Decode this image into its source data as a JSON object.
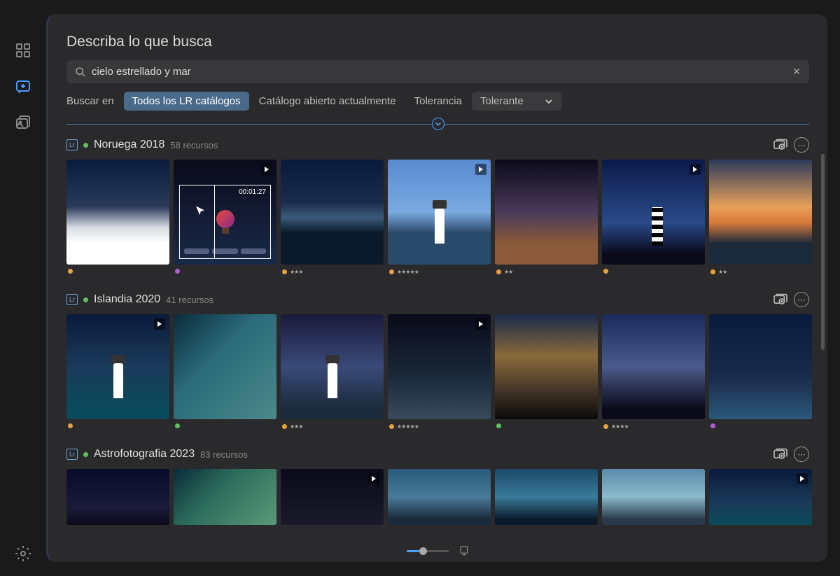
{
  "page_title": "Describa lo que busca",
  "search": {
    "value": "cielo estrellado y mar",
    "placeholder": ""
  },
  "filter": {
    "label": "Buscar en",
    "options": [
      "Todos los LR catálogos",
      "Catálogo abierto actualmente"
    ],
    "active_index": 0,
    "tolerance_label": "Tolerancia",
    "tolerance_value": "Tolerante"
  },
  "groups": [
    {
      "lr": "Lr",
      "dot": "green",
      "title": "Noruega 2018",
      "count": "58 recursos",
      "thumbs": [
        {
          "gradient": "linear-gradient(180deg,#0a1a3a 0%,#2a3a5a 45%,#d8dce4 65%,#fff 80%)",
          "dot": "orange",
          "stars": 0,
          "video": false
        },
        {
          "gradient": "linear-gradient(180deg,#0a0a1a 0%,#1a2a4a 100%)",
          "dot": "purple",
          "stars": 0,
          "video": true,
          "timecode": "00:01:27",
          "has_overlay": true
        },
        {
          "gradient": "linear-gradient(180deg,#0a1a3a 0%,#1a2a4a 40%,#3a5a7a 55%,#0a1a2a 70%)",
          "dot": "orange",
          "stars": 3,
          "video": false
        },
        {
          "gradient": "linear-gradient(180deg,#5a8ad0 0%,#7aaae0 50%,#2a4a6a 70%)",
          "dot": "orange",
          "stars": 5,
          "video": true,
          "lighthouse": true
        },
        {
          "gradient": "linear-gradient(180deg,#0a0a1a 0%,#4a3a5a 50%,#8a5a3a 80%)",
          "dot": "orange",
          "stars": 2,
          "video": false
        },
        {
          "gradient": "linear-gradient(180deg,#0a1a4a 0%,#2a4a8a 60%,#0a0a1a 90%)",
          "dot": "orange",
          "stars": 0,
          "video": true,
          "stripe_lighthouse": true
        },
        {
          "gradient": "linear-gradient(180deg,#2a3a5a 0%,#e8a05a 45%,#d87a3a 60%,#1a2a3a 80%)",
          "dot": "orange",
          "stars": 2,
          "video": false
        }
      ]
    },
    {
      "lr": "Lr",
      "dot": "green",
      "title": "Islandia 2020",
      "count": "41 recursos",
      "thumbs": [
        {
          "gradient": "linear-gradient(180deg,#0a1a3a 0%,#1a3a5a 50%,#0a4a5a 90%)",
          "dot": "orange",
          "stars": 0,
          "video": true,
          "lighthouse": true
        },
        {
          "gradient": "linear-gradient(135deg,#0a2a3a 0%,#2a6a7a 40%,#4a8a8a 100%)",
          "dot": "green",
          "stars": 0,
          "video": false
        },
        {
          "gradient": "linear-gradient(180deg,#1a1a3a 0%,#3a4a7a 50%,#1a2a3a 90%)",
          "dot": "orange",
          "stars": 3,
          "video": false,
          "lighthouse": true
        },
        {
          "gradient": "linear-gradient(180deg,#0a0a1a 0%,#1a2a3a 60%,#3a4a5a 100%)",
          "dot": "orange",
          "stars": 5,
          "video": true
        },
        {
          "gradient": "linear-gradient(180deg,#1a2a4a 0%,#8a6a3a 40%,#4a3a2a 70%,#0a0a0a 100%)",
          "dot": "green",
          "stars": 0,
          "video": false
        },
        {
          "gradient": "linear-gradient(180deg,#1a2a5a 0%,#4a5a8a 50%,#0a0a1a 90%)",
          "dot": "orange",
          "stars": 4,
          "video": false
        },
        {
          "gradient": "linear-gradient(180deg,#0a1a3a 0%,#1a2a4a 60%,#2a5a7a 100%)",
          "dot": "purple",
          "stars": 0,
          "video": false
        }
      ]
    },
    {
      "lr": "Lr",
      "dot": "green",
      "title": "Astrofotografia 2023",
      "count": "83 recursos",
      "thumbs": [
        {
          "gradient": "linear-gradient(180deg,#0a0a2a 0%,#1a1a3a 70%,#0a0a1a 100%)",
          "dot": "",
          "stars": 0,
          "video": false,
          "short": true
        },
        {
          "gradient": "linear-gradient(135deg,#0a2a3a 0%,#2a6a5a 40%,#5a9a7a 100%)",
          "dot": "",
          "stars": 0,
          "video": false,
          "short": true
        },
        {
          "gradient": "linear-gradient(180deg,#0a0a1a 0%,#1a1a2a 100%)",
          "dot": "",
          "stars": 0,
          "video": true,
          "short": true
        },
        {
          "gradient": "linear-gradient(180deg,#2a5a7a 0%,#4a7a9a 50%,#1a2a3a 90%)",
          "dot": "",
          "stars": 0,
          "video": false,
          "short": true
        },
        {
          "gradient": "linear-gradient(180deg,#1a4a6a 0%,#3a7a9a 50%,#0a1a2a 90%)",
          "dot": "",
          "stars": 0,
          "video": false,
          "short": true
        },
        {
          "gradient": "linear-gradient(180deg,#5a8aaa 0%,#8abaca 50%,#2a3a4a 90%)",
          "dot": "",
          "stars": 0,
          "video": false,
          "short": true
        },
        {
          "gradient": "linear-gradient(180deg,#0a1a3a 0%,#1a3a5a 60%,#0a4a5a 100%)",
          "dot": "",
          "stars": 0,
          "video": true,
          "short": true
        }
      ]
    }
  ]
}
